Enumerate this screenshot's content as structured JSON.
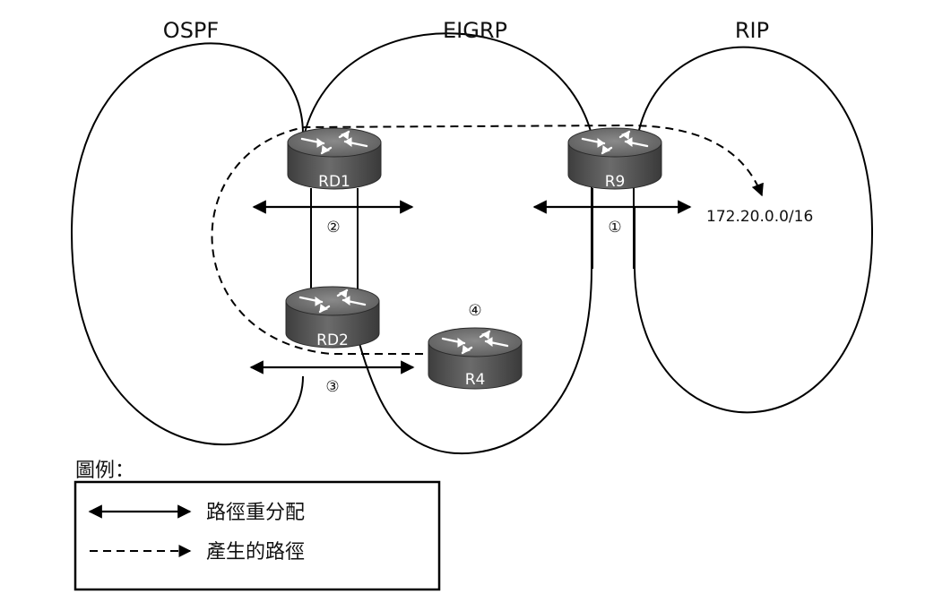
{
  "domains": [
    {
      "id": "ospf",
      "label": "OSPF"
    },
    {
      "id": "eigrp",
      "label": "EIGRP"
    },
    {
      "id": "rip",
      "label": "RIP"
    }
  ],
  "routers": [
    {
      "id": "rd1",
      "label": "RD1"
    },
    {
      "id": "rd2",
      "label": "RD2"
    },
    {
      "id": "r4",
      "label": "R4"
    },
    {
      "id": "r9",
      "label": "R9"
    }
  ],
  "steps": [
    "①",
    "②",
    "③",
    "④"
  ],
  "prefix": "172.20.0.0/16",
  "legend": {
    "title": "圖例：",
    "items": [
      {
        "symbol": "double-arrow",
        "label": "路徑重分配"
      },
      {
        "symbol": "dashed-arrow",
        "label": "產生的路徑"
      }
    ]
  }
}
